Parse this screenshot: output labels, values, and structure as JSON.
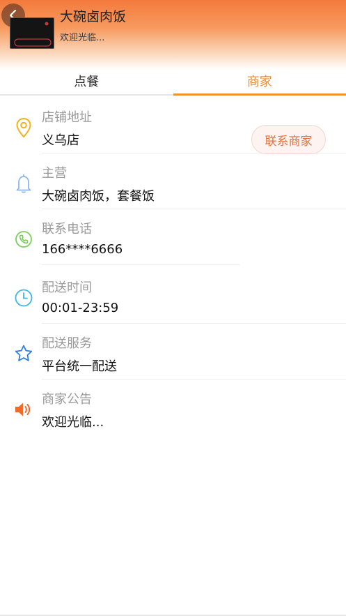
{
  "header": {
    "shop_name": "大碗卤肉饭",
    "subtitle": "欢迎光临...",
    "logo_text": "大碗卤肉饭",
    "back_icon": "chevron-left-icon"
  },
  "tabs": [
    {
      "label": "点餐",
      "active": false
    },
    {
      "label": "商家",
      "active": true
    }
  ],
  "info": {
    "address": {
      "label": "店铺地址",
      "value": "义乌店",
      "icon": "location-pin-icon"
    },
    "main_business": {
      "label": "主营",
      "value": "大碗卤肉饭，套餐饭",
      "icon": "bell-icon"
    },
    "phone": {
      "label": "联系电话",
      "value": "166****6666",
      "icon": "phone-icon"
    },
    "delivery_time": {
      "label": "配送时间",
      "value": "00:01-23:59",
      "icon": "clock-icon"
    },
    "delivery_service": {
      "label": "配送服务",
      "value": "平台统一配送",
      "icon": "star-icon"
    },
    "notice": {
      "label": "商家公告",
      "value": "欢迎光临...",
      "icon": "speaker-icon"
    }
  },
  "contact_button": {
    "label": "联系商家"
  },
  "colors": {
    "accent": "#f08a2b",
    "header_orange": "#f47a3c",
    "label_gray": "#9a9a9a",
    "pin_yellow": "#f3b21c",
    "bell_blue": "#8fb6ef",
    "phone_green": "#7ccd55",
    "clock_cyan": "#3fb6e8",
    "star_blue": "#2d7fe0",
    "speaker_orange": "#f06a2a"
  }
}
